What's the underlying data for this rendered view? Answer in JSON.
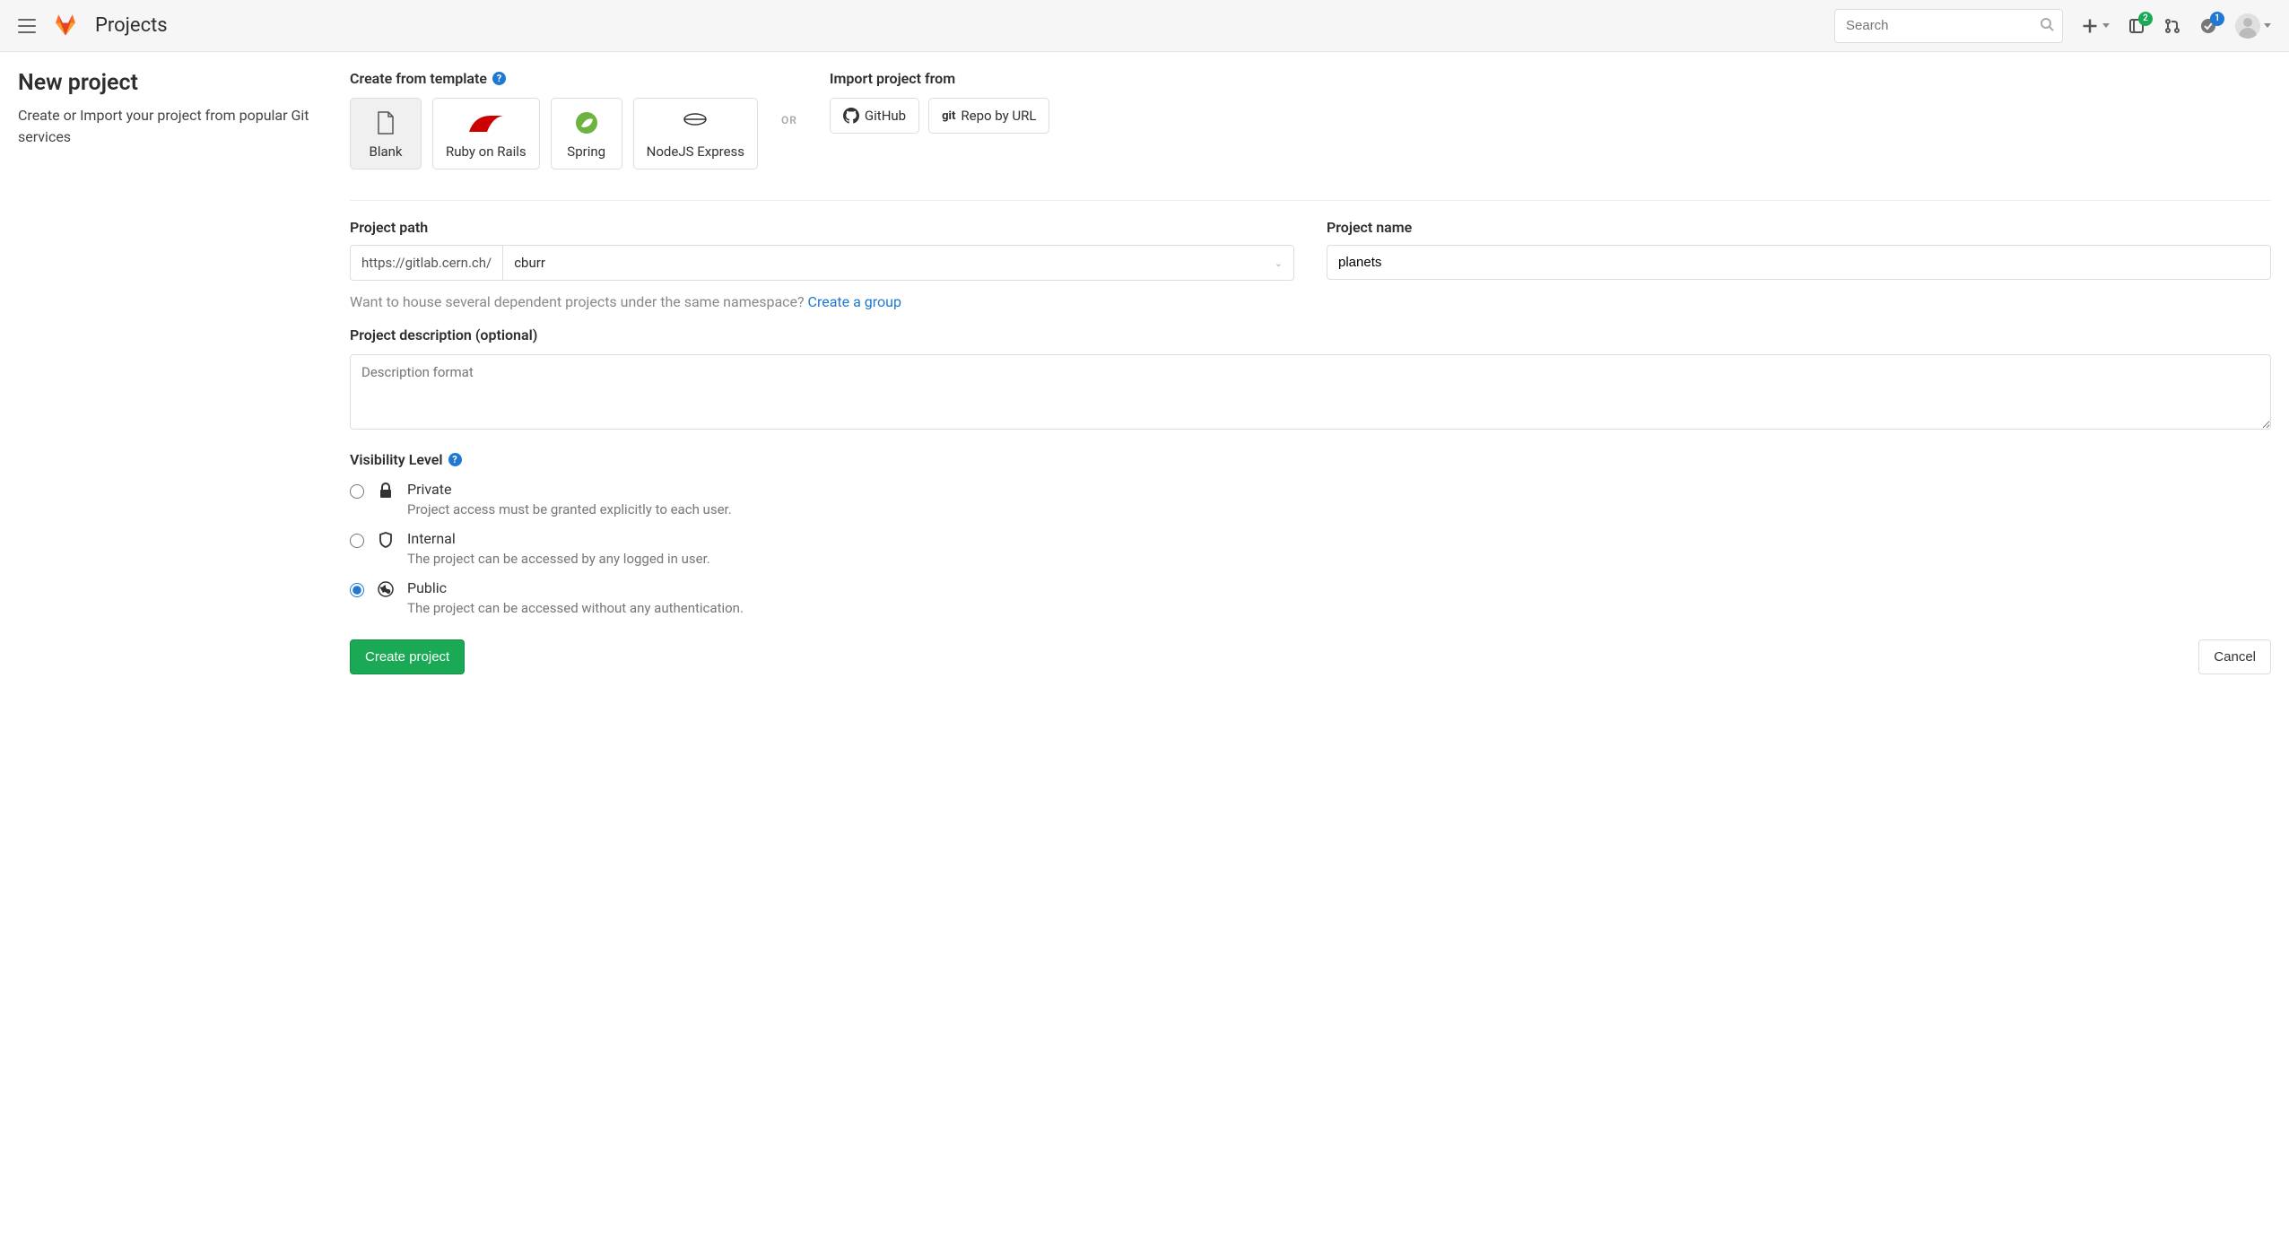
{
  "header": {
    "page_title": "Projects",
    "search_placeholder": "Search",
    "issues_badge": "2",
    "todos_badge": "1"
  },
  "sidebar": {
    "heading": "New project",
    "subtext": "Create or Import your project from popular Git services"
  },
  "templates": {
    "label": "Create from template",
    "options": [
      {
        "label": "Blank",
        "active": true
      },
      {
        "label": "Ruby on Rails",
        "active": false
      },
      {
        "label": "Spring",
        "active": false
      },
      {
        "label": "NodeJS Express",
        "active": false
      }
    ],
    "or": "OR"
  },
  "import": {
    "label": "Import project from",
    "github": "GitHub",
    "repo_by_url": "Repo by URL",
    "git_prefix": "git"
  },
  "form": {
    "path_label": "Project path",
    "path_prefix": "https://gitlab.cern.ch/",
    "namespace": "cburr",
    "name_label": "Project name",
    "name_value": "planets",
    "namespace_hint": "Want to house several dependent projects under the same namespace? ",
    "create_group_link": "Create a group",
    "desc_label": "Project description (optional)",
    "desc_placeholder": "Description format",
    "visibility_label": "Visibility Level",
    "visibility": [
      {
        "key": "private",
        "title": "Private",
        "desc": "Project access must be granted explicitly to each user.",
        "checked": false
      },
      {
        "key": "internal",
        "title": "Internal",
        "desc": "The project can be accessed by any logged in user.",
        "checked": false
      },
      {
        "key": "public",
        "title": "Public",
        "desc": "The project can be accessed without any authentication.",
        "checked": true
      }
    ],
    "submit": "Create project",
    "cancel": "Cancel"
  }
}
